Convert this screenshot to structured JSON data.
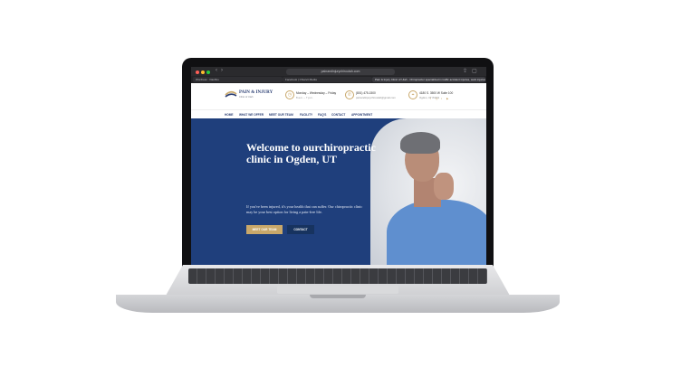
{
  "browser": {
    "url": "painandinjurychiroutah.com",
    "tabs": [
      "Wordress · Dashbo",
      "Facebook | Chiarvit Media",
      "Pain & Injury Clinic of Utah - Chiropractor specialized in traffic accident injuries, work injuries and sports"
    ]
  },
  "site": {
    "brand": "PAIN & INJURY",
    "brand_sub": "Clinic of Utah",
    "hours_title": "Monday – Wednesday – Friday",
    "hours_sub": "8 a.m. – 7 p.m.",
    "phone_title": "(801) 475-1500",
    "phone_sub": "painandinjurychiroutah@gmail.com",
    "address_title": "4180 S. 3500 W Suite 100",
    "address_sub": "Ogden, UT 84401"
  },
  "nav": [
    "HOME",
    "WHAT WE OFFER",
    "MEET OUR TEAM",
    "FACILITY",
    "FAQ'S",
    "CONTACT",
    "APPOINTMENT"
  ],
  "hero": {
    "title": "Welcome to ourchiropractic clinic in Ogden, UT",
    "text": "If you've been injured, it's your health that can suffer. Our chiropractic clinic may be your best option for living a pain-free life.",
    "btn_team": "MEET OUR TEAM",
    "btn_contact": "CONTACT"
  },
  "colors": {
    "navy": "#1f3f7c",
    "gold": "#c9a86a"
  }
}
